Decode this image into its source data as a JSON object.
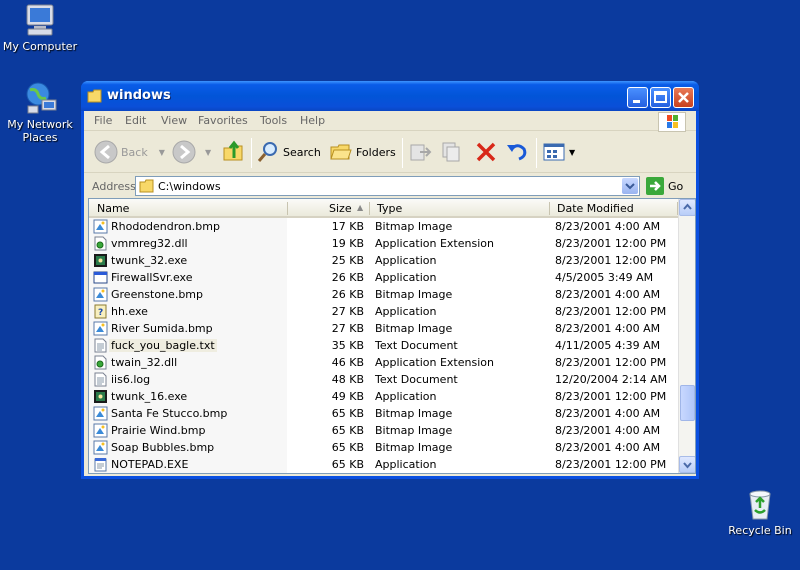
{
  "desktop": {
    "icons": [
      {
        "label": "My Computer"
      },
      {
        "label": "My Network Places"
      },
      {
        "label": "Recycle Bin"
      }
    ]
  },
  "window": {
    "title": "windows",
    "menu": [
      "File",
      "Edit",
      "View",
      "Favorites",
      "Tools",
      "Help"
    ],
    "toolbar": {
      "back_label": "Back",
      "search_label": "Search",
      "folders_label": "Folders"
    },
    "address": {
      "label": "Address",
      "value": "C:\\windows",
      "go_label": "Go"
    },
    "columns": [
      "Name",
      "Size",
      "Type",
      "Date Modified"
    ],
    "files": [
      {
        "name": "Rhododendron.bmp",
        "size": "17 KB",
        "type": "Bitmap Image",
        "date": "8/23/2001 4:00 AM",
        "icon": "bitmap-icon"
      },
      {
        "name": "vmmreg32.dll",
        "size": "19 KB",
        "type": "Application Extension",
        "date": "8/23/2001 12:00 PM",
        "icon": "dll-icon"
      },
      {
        "name": "twunk_32.exe",
        "size": "25 KB",
        "type": "Application",
        "date": "8/23/2001 12:00 PM",
        "icon": "twain-app-icon"
      },
      {
        "name": "FirewallSvr.exe",
        "size": "26 KB",
        "type": "Application",
        "date": "4/5/2005 3:49 AM",
        "icon": "window-app-icon"
      },
      {
        "name": "Greenstone.bmp",
        "size": "26 KB",
        "type": "Bitmap Image",
        "date": "8/23/2001 4:00 AM",
        "icon": "bitmap-icon"
      },
      {
        "name": "hh.exe",
        "size": "27 KB",
        "type": "Application",
        "date": "8/23/2001 12:00 PM",
        "icon": "help-app-icon"
      },
      {
        "name": "River Sumida.bmp",
        "size": "27 KB",
        "type": "Bitmap Image",
        "date": "8/23/2001 4:00 AM",
        "icon": "bitmap-icon"
      },
      {
        "name": "fuck_you_bagle.txt",
        "size": "35 KB",
        "type": "Text Document",
        "date": "4/11/2005 4:39 AM",
        "icon": "text-file-icon"
      },
      {
        "name": "twain_32.dll",
        "size": "46 KB",
        "type": "Application Extension",
        "date": "8/23/2001 12:00 PM",
        "icon": "dll-icon"
      },
      {
        "name": "iis6.log",
        "size": "48 KB",
        "type": "Text Document",
        "date": "12/20/2004 2:14 AM",
        "icon": "text-file-icon"
      },
      {
        "name": "twunk_16.exe",
        "size": "49 KB",
        "type": "Application",
        "date": "8/23/2001 12:00 PM",
        "icon": "twain-app-icon"
      },
      {
        "name": "Santa Fe Stucco.bmp",
        "size": "65 KB",
        "type": "Bitmap Image",
        "date": "8/23/2001 4:00 AM",
        "icon": "bitmap-icon"
      },
      {
        "name": "Prairie Wind.bmp",
        "size": "65 KB",
        "type": "Bitmap Image",
        "date": "8/23/2001 4:00 AM",
        "icon": "bitmap-icon"
      },
      {
        "name": "Soap Bubbles.bmp",
        "size": "65 KB",
        "type": "Bitmap Image",
        "date": "8/23/2001 4:00 AM",
        "icon": "bitmap-icon"
      },
      {
        "name": "NOTEPAD.EXE",
        "size": "65 KB",
        "type": "Application",
        "date": "8/23/2001 12:00 PM",
        "icon": "notepad-app-icon"
      }
    ],
    "selected_file_index": 7,
    "scroll_position": 0.72
  },
  "colors": {
    "desktop_bg": "#0b3a9e",
    "titlebar": "#0255d8",
    "close_button": "#c8401e",
    "window_bg": "#ece9d8"
  }
}
